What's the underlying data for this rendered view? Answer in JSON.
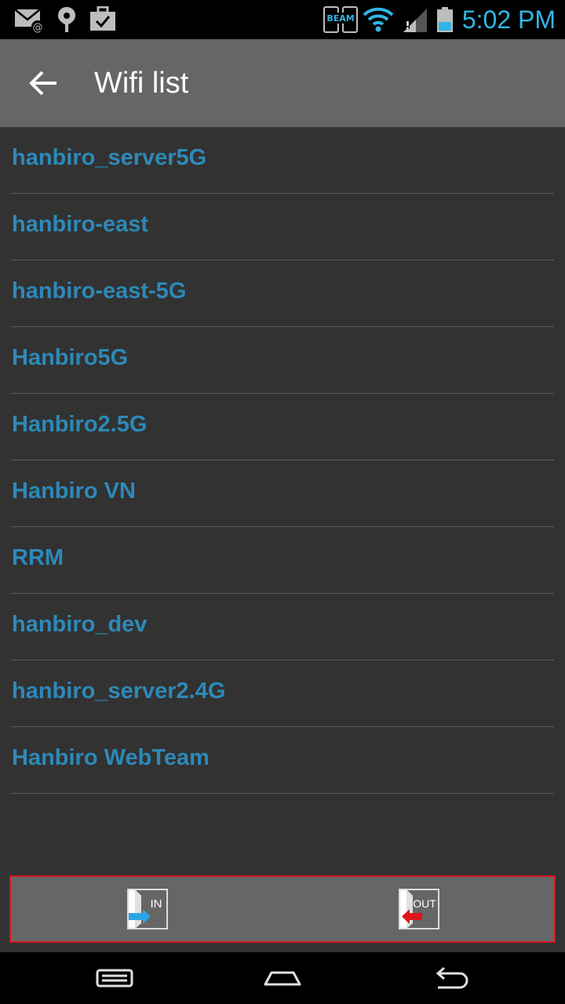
{
  "status_bar": {
    "time": "5:02 PM",
    "icons": [
      "email-icon",
      "location-icon",
      "briefcase-icon",
      "beam-icon",
      "wifi-icon",
      "signal-icon",
      "battery-icon"
    ],
    "beam_text": "BEAM",
    "accent_color": "#33b5e5"
  },
  "action_bar": {
    "title": "Wifi list",
    "background": "#666666"
  },
  "wifi_list": {
    "items": [
      {
        "label": "hanbiro_server5G"
      },
      {
        "label": "hanbiro-east"
      },
      {
        "label": "hanbiro-east-5G"
      },
      {
        "label": "Hanbiro5G"
      },
      {
        "label": "Hanbiro2.5G"
      },
      {
        "label": "Hanbiro VN"
      },
      {
        "label": "RRM"
      },
      {
        "label": "hanbiro_dev"
      },
      {
        "label": "hanbiro_server2.4G"
      },
      {
        "label": "Hanbiro WebTeam"
      }
    ],
    "text_color": "#2d89b8"
  },
  "bottom_bar": {
    "in_label": "IN",
    "out_label": "OUT",
    "border_color": "#d8141c"
  },
  "nav_bar": {
    "icons": [
      "recent-apps-icon",
      "home-icon",
      "back-nav-icon"
    ]
  }
}
